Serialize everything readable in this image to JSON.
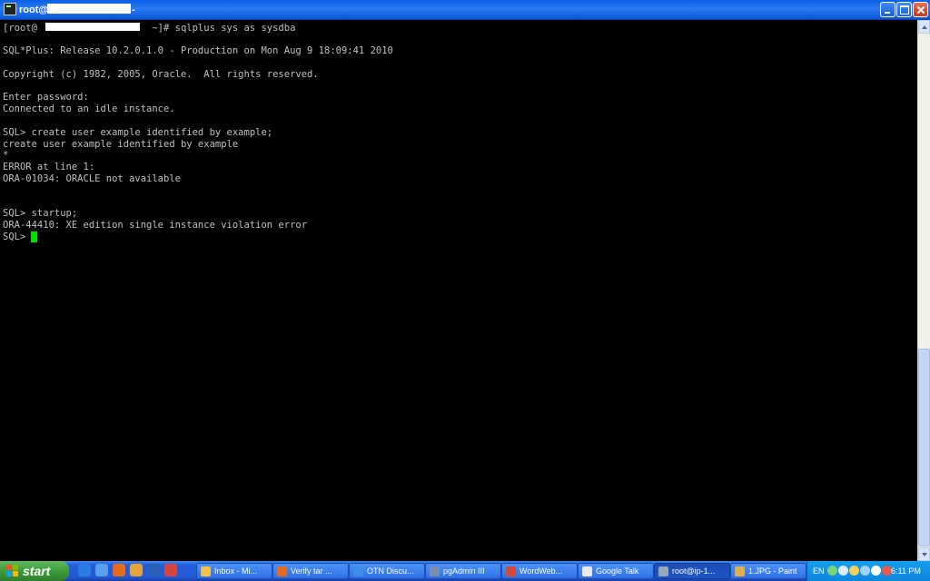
{
  "window": {
    "title_prefix": "root@",
    "title_suffix": "-"
  },
  "terminal": {
    "lines": [
      "[root@                    ~]# sqlplus sys as sysdba",
      "",
      "SQL*Plus: Release 10.2.0.1.0 - Production on Mon Aug 9 18:09:41 2010",
      "",
      "Copyright (c) 1982, 2005, Oracle.  All rights reserved.",
      "",
      "Enter password:",
      "Connected to an idle instance.",
      "",
      "SQL> create user example identified by example;",
      "create user example identified by example",
      "*",
      "ERROR at line 1:",
      "ORA-01034: ORACLE not available",
      "",
      "",
      "",
      "SQL> startup;",
      "ORA-44410: XE edition single instance violation error",
      "SQL> "
    ]
  },
  "taskbar": {
    "start_label": "start",
    "quick_launch": [
      {
        "icon": "ie-icon",
        "color": "#2a7de1"
      },
      {
        "icon": "explorer-icon",
        "color": "#5aa0ef"
      },
      {
        "icon": "firefox-icon",
        "color": "#e66a1f"
      },
      {
        "icon": "thunderbird-icon",
        "color": "#e8a33a"
      },
      {
        "icon": "word-icon",
        "color": "#2b5fb8"
      },
      {
        "icon": "chrome-icon",
        "color": "#d9453b"
      }
    ],
    "tasks": [
      {
        "label": "Inbox - Mi...",
        "icon": "outlook-icon",
        "color": "#f2c14e",
        "active": false
      },
      {
        "label": "Verify tar ...",
        "icon": "firefox-icon",
        "color": "#e66a1f",
        "active": false
      },
      {
        "label": "OTN Discu...",
        "icon": "ie-icon",
        "color": "#3a8de8",
        "active": false
      },
      {
        "label": "pgAdmin III",
        "icon": "pgadmin-icon",
        "color": "#7a8fb0",
        "active": false
      },
      {
        "label": "WordWeb...",
        "icon": "wordweb-icon",
        "color": "#d24a3a",
        "active": false
      },
      {
        "label": "Google Talk",
        "icon": "chat-icon",
        "color": "#eaeaea",
        "active": false
      },
      {
        "label": "root@ip-1...",
        "icon": "putty-icon",
        "color": "#9aa6b6",
        "active": true
      },
      {
        "label": "1.JPG - Paint",
        "icon": "paint-icon",
        "color": "#e0b04a",
        "active": false
      }
    ],
    "tray": {
      "language": "EN",
      "clock": "6:11 PM",
      "icons": [
        {
          "icon": "network-icon",
          "color": "#7fd37a"
        },
        {
          "icon": "monitor-icon",
          "color": "#dfe9f7"
        },
        {
          "icon": "shield-icon",
          "color": "#f3d15b"
        },
        {
          "icon": "talk-icon",
          "color": "#9fd4ff"
        },
        {
          "icon": "volume-icon",
          "color": "#ffffff"
        },
        {
          "icon": "antivirus-icon",
          "color": "#e85b4a"
        }
      ]
    }
  }
}
